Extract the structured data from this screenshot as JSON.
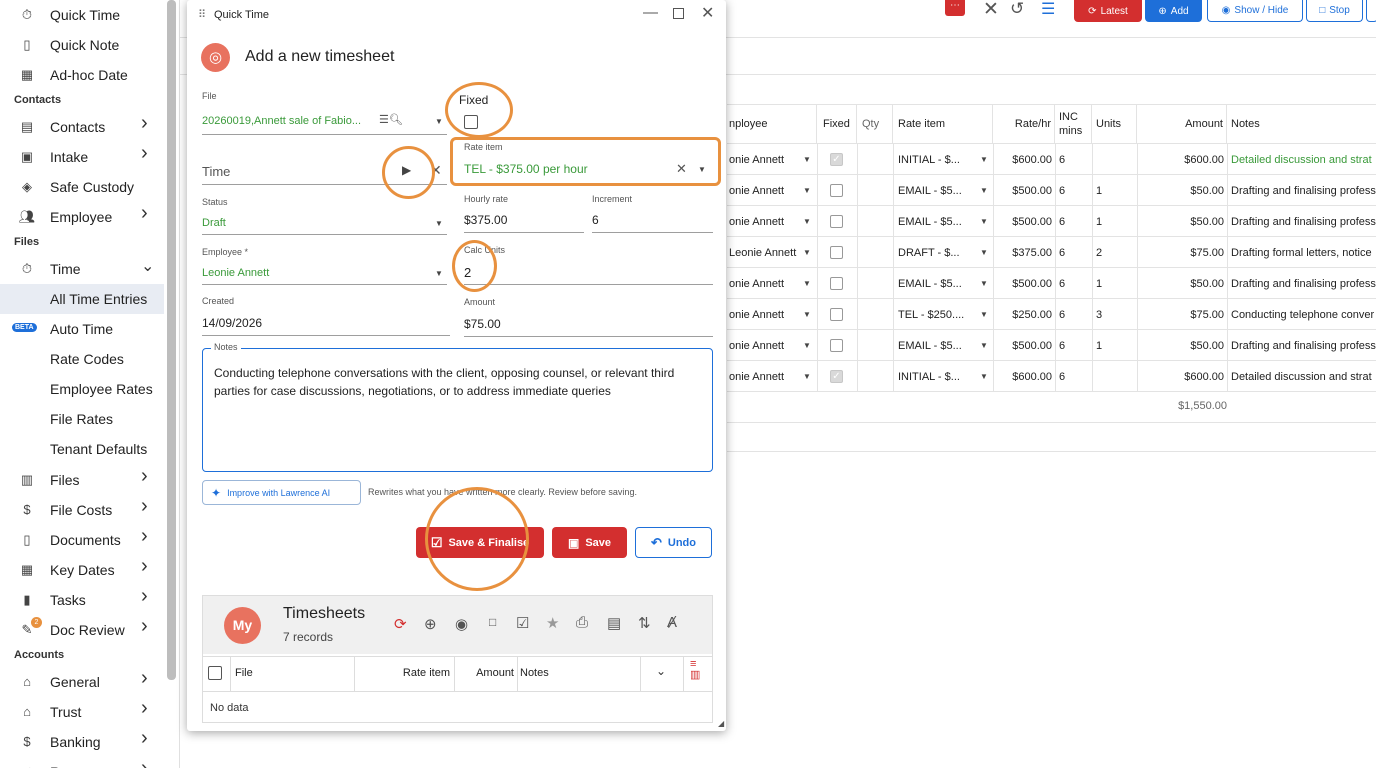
{
  "sidebar": {
    "items": [
      {
        "label": "Quick Time",
        "icon": "stopwatch-icon"
      },
      {
        "label": "Quick Note",
        "icon": "document-icon"
      },
      {
        "label": "Ad-hoc Date",
        "icon": "calendar-icon"
      },
      {
        "label": "Contacts",
        "icon": "contact-card-icon",
        "chevron": ">"
      },
      {
        "label": "Intake",
        "icon": "inbox-icon",
        "chevron": ">"
      },
      {
        "label": "Safe Custody",
        "icon": "safe-icon"
      },
      {
        "label": "Employee",
        "icon": "people-icon",
        "chevron": ">"
      },
      {
        "label": "Time",
        "icon": "stopwatch-icon",
        "chevron": "v"
      },
      {
        "label": "All Time Entries"
      },
      {
        "label": "Auto Time",
        "badge": "BETA"
      },
      {
        "label": "Rate Codes"
      },
      {
        "label": "Employee Rates"
      },
      {
        "label": "File Rates"
      },
      {
        "label": "Tenant Defaults"
      },
      {
        "label": "Files",
        "icon": "files-icon",
        "chevron": ">"
      },
      {
        "label": "File Costs",
        "icon": "dollar-icon",
        "chevron": ">"
      },
      {
        "label": "Documents",
        "icon": "document-icon",
        "chevron": ">"
      },
      {
        "label": "Key Dates",
        "icon": "calendar-icon",
        "chevron": ">"
      },
      {
        "label": "Tasks",
        "icon": "bar-chart-icon",
        "chevron": ">"
      },
      {
        "label": "Doc Review",
        "icon": "review-icon",
        "chevron": ">",
        "count": "2"
      },
      {
        "label": "General",
        "icon": "bank-icon",
        "chevron": ">"
      },
      {
        "label": "Trust",
        "icon": "bank-icon",
        "chevron": ">"
      },
      {
        "label": "Banking",
        "icon": "dollar-icon",
        "chevron": ">"
      },
      {
        "label": "Recon",
        "icon": "check-icon",
        "chevron": ">"
      }
    ],
    "sections": {
      "contacts": "Contacts",
      "files": "Files",
      "accounts": "Accounts"
    }
  },
  "toolbar": {
    "latest": "Latest",
    "add": "Add",
    "show_hide": "Show / Hide",
    "stop": "Stop"
  },
  "grid": {
    "headers": {
      "employee": "nployee",
      "fixed": "Fixed",
      "qty": "Qty",
      "rate_item": "Rate item",
      "rate_hr": "Rate/hr",
      "inc": "INC mins",
      "units": "Units",
      "amount": "Amount",
      "notes": "Notes"
    },
    "rows": [
      {
        "employee": "onie Annett",
        "fixed": true,
        "rate_item": "INITIAL - $...",
        "rate": "$600.00",
        "inc": "6",
        "units": "",
        "amount": "$600.00",
        "notes": "Detailed discussion and strat",
        "notes_green": true
      },
      {
        "employee": "onie Annett",
        "fixed": false,
        "rate_item": "EMAIL - $5...",
        "rate": "$500.00",
        "inc": "6",
        "units": "1",
        "amount": "$50.00",
        "notes": "Drafting and finalising profess"
      },
      {
        "employee": "onie Annett",
        "fixed": false,
        "rate_item": "EMAIL - $5...",
        "rate": "$500.00",
        "inc": "6",
        "units": "1",
        "amount": "$50.00",
        "notes": "Drafting and finalising profess"
      },
      {
        "employee": "Leonie Annett",
        "fixed": false,
        "rate_item": "DRAFT - $...",
        "rate": "$375.00",
        "inc": "6",
        "units": "2",
        "amount": "$75.00",
        "notes": "Drafting formal letters, notice"
      },
      {
        "employee": "onie Annett",
        "fixed": false,
        "rate_item": "EMAIL - $5...",
        "rate": "$500.00",
        "inc": "6",
        "units": "1",
        "amount": "$50.00",
        "notes": "Drafting and finalising profess"
      },
      {
        "employee": "onie Annett",
        "fixed": false,
        "rate_item": "TEL - $250....",
        "rate": "$250.00",
        "inc": "6",
        "units": "3",
        "amount": "$75.00",
        "notes": "Conducting telephone conver"
      },
      {
        "employee": "onie Annett",
        "fixed": false,
        "rate_item": "EMAIL - $5...",
        "rate": "$500.00",
        "inc": "6",
        "units": "1",
        "amount": "$50.00",
        "notes": "Drafting and finalising profess"
      },
      {
        "employee": "onie Annett",
        "fixed": true,
        "rate_item": "INITIAL - $...",
        "rate": "$600.00",
        "inc": "6",
        "units": "",
        "amount": "$600.00",
        "notes": "Detailed discussion and strat"
      }
    ],
    "total": "$1,550.00"
  },
  "dialog": {
    "window_title": "Quick Time",
    "heading": "Add a new timesheet",
    "file_label": "File",
    "file_value": "20260019,Annett sale of Fabio...",
    "fixed_label": "Fixed",
    "time_placeholder": "Time",
    "rate_item_label": "Rate item",
    "rate_item_value": "TEL - $375.00 per hour",
    "status_label": "Status",
    "status_value": "Draft",
    "hourly_rate_label": "Hourly rate",
    "hourly_rate_value": "$375.00",
    "increment_label": "Increment",
    "increment_value": "6",
    "employee_label": "Employee *",
    "employee_value": "Leonie Annett",
    "calc_units_label": "Calc Units",
    "calc_units_value": "2",
    "created_label": "Created",
    "created_value": "14/09/2026",
    "amount_label": "Amount",
    "amount_value": "$75.00",
    "notes_label": "Notes",
    "notes_value": "Conducting telephone conversations with the client, opposing counsel, or relevant third parties for case discussions, negotiations, or to address immediate queries",
    "improve_label": "Improve with Lawrence AI",
    "improve_hint": "Rewrites what you have written more clearly. Review before saving.",
    "save_finalise": "Save & Finalise",
    "save": "Save",
    "undo": "Undo",
    "timesheets_avatar": "My",
    "timesheets_title": "Timesheets",
    "timesheets_count": "7 records",
    "sub_headers": {
      "file": "File",
      "rate_item": "Rate item",
      "amount": "Amount",
      "notes": "Notes"
    },
    "no_data": "No data"
  },
  "colors": {
    "accent_red": "#d32f2f",
    "accent_blue": "#1e6fd9",
    "highlight": "#e8913f",
    "green": "#3a9a3a"
  }
}
